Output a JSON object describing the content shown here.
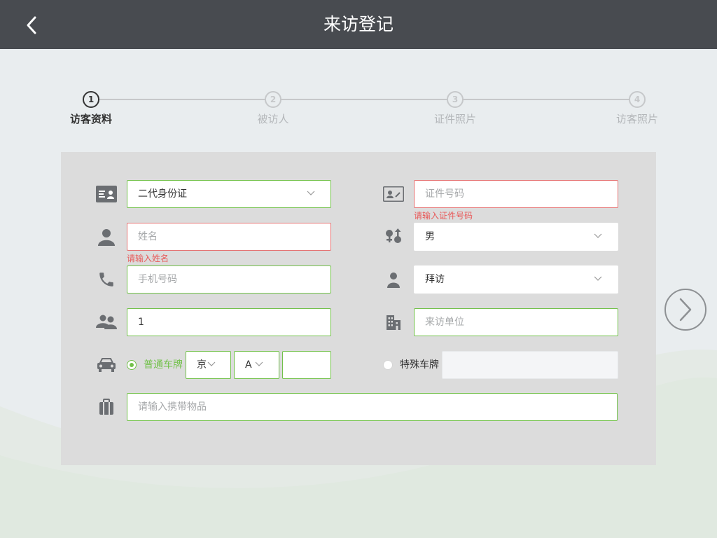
{
  "header": {
    "title": "来访登记",
    "back_icon": "chevron-left-icon"
  },
  "steps": [
    {
      "number": "1",
      "label": "访客资料",
      "active": true
    },
    {
      "number": "2",
      "label": "被访人",
      "active": false
    },
    {
      "number": "3",
      "label": "证件照片",
      "active": false
    },
    {
      "number": "4",
      "label": "访客照片",
      "active": false
    }
  ],
  "form": {
    "id_type": {
      "value": "二代身份证",
      "icon": "id-card-icon"
    },
    "id_number": {
      "placeholder": "证件号码",
      "error": "请输入证件号码",
      "icon": "id-badge-icon"
    },
    "name": {
      "placeholder": "姓名",
      "error": "请输入姓名",
      "icon": "person-icon"
    },
    "gender": {
      "value": "男",
      "icon": "gender-icon"
    },
    "phone": {
      "placeholder": "手机号码",
      "icon": "phone-icon"
    },
    "visit_type": {
      "value": "拜访",
      "icon": "visitor-icon"
    },
    "visitor_count": {
      "value": "1",
      "icon": "group-icon"
    },
    "company": {
      "placeholder": "来访单位",
      "icon": "building-icon"
    },
    "plate": {
      "icon": "car-icon",
      "normal_label": "普通车牌",
      "province": "京",
      "letter": "A",
      "number": "",
      "special_label": "特殊车牌",
      "selected": "normal"
    },
    "belongings": {
      "placeholder": "请输入携带物品",
      "icon": "luggage-icon"
    }
  },
  "next_icon": "chevron-right-circle-icon",
  "colors": {
    "header_bg": "#484b50",
    "accent_green": "#72c14a",
    "error_red": "#e85a5a",
    "panel_bg": "#dcdcdc",
    "page_bg": "#e9edef"
  }
}
